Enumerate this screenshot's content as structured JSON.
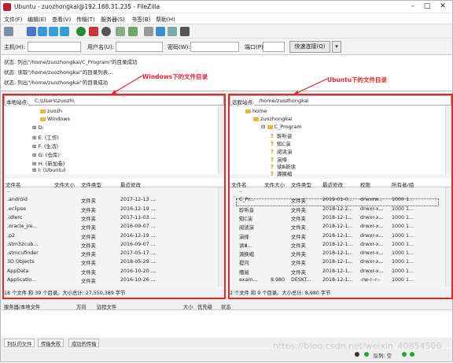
{
  "window": {
    "title": "Ubuntu - zuozhongkai@192.168.31.235 - FileZilla",
    "min": "–",
    "max": "□",
    "close": "✕"
  },
  "menu": [
    "文件(F)",
    "编辑(E)",
    "查看(V)",
    "传输(T)",
    "服务器(S)",
    "书签(B)",
    "帮助(H)"
  ],
  "quick": {
    "host_label": "主机(H):",
    "user_label": "用户名(U):",
    "pass_label": "密码(W):",
    "port_label": "端口(P):",
    "connect": "快速连接(Q)",
    "dropdown": "▾"
  },
  "log": [
    "状态:  列出\"/home/zuozhongkai/C_Program\"的目录成功",
    "状态:  读取\"/home/zuozhongkai\"的目录列表...",
    "状态:  列出\"/home/zuozhongkai\"的目录成功"
  ],
  "annotations": {
    "windows": "Windows下的文件目录",
    "ubuntu": "Ubuntu下的文件目录"
  },
  "local": {
    "site_label": "本地站点:",
    "site_value": "C:\\Users\\zuozh\\",
    "tree": [
      "zuozh",
      "Windows",
      "D:",
      "E: (工作)",
      "F: (生活)",
      "G: (仓库)",
      "H: (新加卷)",
      "I: (Ubuntu)"
    ],
    "headers": [
      "文件名",
      "文件大小",
      "文件类型",
      "最近修改"
    ],
    "files": [
      {
        "name": "..",
        "size": "",
        "type": "",
        "mod": ""
      },
      {
        "name": ".android",
        "size": "",
        "type": "文件夹",
        "mod": "2017-12-13 ..."
      },
      {
        "name": ".eclipse",
        "size": "",
        "type": "文件夹",
        "mod": "2016-12-19 ..."
      },
      {
        "name": ".idlerc",
        "size": "",
        "type": "文件夹",
        "mod": "2017-11-03 ..."
      },
      {
        "name": ".oracle_jre...",
        "size": "",
        "type": "文件夹",
        "mod": "2016-09-07 ..."
      },
      {
        "name": ".p2",
        "size": "",
        "type": "文件夹",
        "mod": "2016-12-19 ..."
      },
      {
        "name": ".stm32cub...",
        "size": "",
        "type": "文件夹",
        "mod": "2016-09-07 ..."
      },
      {
        "name": ".stmcufinder",
        "size": "",
        "type": "文件夹",
        "mod": "2017-05-17 ..."
      },
      {
        "name": "3D Objects",
        "size": "",
        "type": "文件夹",
        "mod": "2018-05-29 ..."
      },
      {
        "name": "AppData",
        "size": "",
        "type": "文件夹",
        "mod": "2016-10-20 ..."
      },
      {
        "name": "Applicatio...",
        "size": "",
        "type": "文件夹",
        "mod": "2016-10-26 ..."
      }
    ],
    "status": "18 个文件 和 39 个目录。大小总计: 27,550,389 字节"
  },
  "remote": {
    "site_label": "远程站点:",
    "site_value": "/home/zuozhongkai",
    "tree": [
      "/",
      "home",
      "zuozhongkai",
      "C_Program",
      "聆听音",
      "知C演",
      "阅读演",
      "演绎",
      "读Ⅲ新读",
      "源换缩"
    ],
    "headers": [
      "文件名",
      "文件大小",
      "文件类型",
      "最近修改",
      "权限",
      "所有者/组"
    ],
    "files": [
      {
        "name": "..",
        "size": "",
        "type": "",
        "mod": "",
        "perm": "",
        "owner": ""
      },
      {
        "name": "C_Pr...",
        "size": "",
        "type": "文件夹",
        "mod": "2019-01-0...",
        "perm": "drwxrw...",
        "owner": "1000 1..."
      },
      {
        "name": "聆听音",
        "size": "",
        "type": "文件夹",
        "mod": "2018-12-2...",
        "perm": "drwxr-x...",
        "owner": "1000 1..."
      },
      {
        "name": "知C演",
        "size": "",
        "type": "文件夹",
        "mod": "2018-12-1...",
        "perm": "drwxr-x...",
        "owner": "1000 1..."
      },
      {
        "name": "阅读演",
        "size": "",
        "type": "文件夹",
        "mod": "2018-12-1...",
        "perm": "drwxr-x...",
        "owner": "1000 1..."
      },
      {
        "name": "演绎",
        "size": "",
        "type": "文件夹",
        "mod": "2018-12-1...",
        "perm": "drwxr-x...",
        "owner": "1000 1..."
      },
      {
        "name": "读Ⅲ...",
        "size": "",
        "type": "文件夹",
        "mod": "2018-12-1...",
        "perm": "drwxr-x...",
        "owner": "1000 1..."
      },
      {
        "name": "源换缩",
        "size": "",
        "type": "文件夹",
        "mod": "2018-12-1...",
        "perm": "drwxr-x...",
        "owner": "1000 1..."
      },
      {
        "name": "提问",
        "size": "",
        "type": "文件夹",
        "mod": "2018-12-1...",
        "perm": "drwxr-x...",
        "owner": "1000 1..."
      },
      {
        "name": "赠阅",
        "size": "",
        "type": "文件夹",
        "mod": "2018-12-1...",
        "perm": "drwxr-x...",
        "owner": "1000 1..."
      },
      {
        "name": "exam...",
        "size": "8,980",
        "type": "DESKT...",
        "mod": "2018-12-1...",
        "perm": "-rw-r--r--",
        "owner": "1000 1..."
      }
    ],
    "status": "2 个文件 和 9 个目录。大小总计: 8,980 字节"
  },
  "queue": {
    "headers": [
      "服务器/本地文件",
      "方向",
      "远程文件",
      "大小",
      "优先级",
      "状态"
    ]
  },
  "tabs": [
    "列队的文件",
    "传输失败",
    "成功的传输"
  ],
  "statusbar": {
    "queue": "队列: 空"
  },
  "watermark": "https://blog.csdn.net/weixin_40854506"
}
